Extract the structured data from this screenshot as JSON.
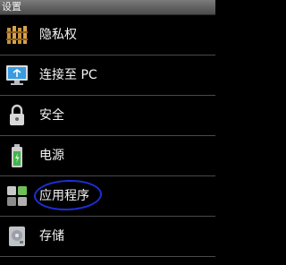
{
  "header": {
    "title": "设置"
  },
  "settings": {
    "items": [
      {
        "label": "隐私权",
        "icon": "privacy-fence-icon"
      },
      {
        "label": "连接至 PC",
        "icon": "pc-monitor-icon"
      },
      {
        "label": "安全",
        "icon": "lock-icon"
      },
      {
        "label": "电源",
        "icon": "battery-icon"
      },
      {
        "label": "应用程序",
        "icon": "apps-grid-icon",
        "annotated": true
      },
      {
        "label": "存储",
        "icon": "storage-disk-icon"
      }
    ]
  },
  "colors": {
    "background": "#000000",
    "annotation": "#1c2fd8"
  }
}
